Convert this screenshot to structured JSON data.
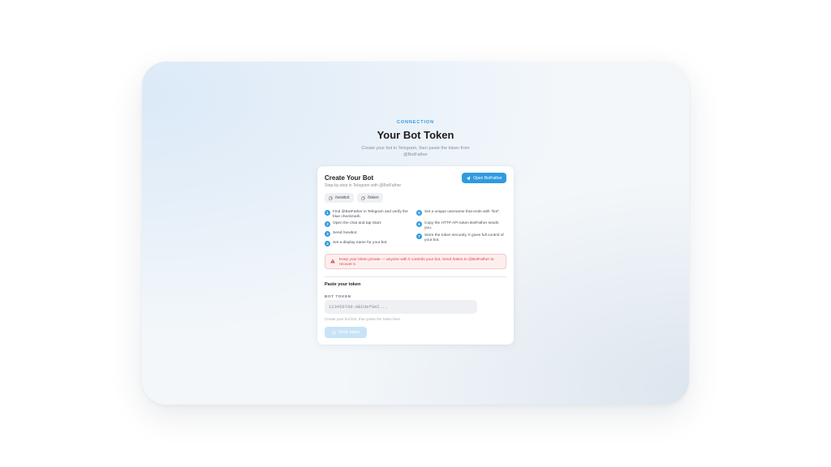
{
  "header": {
    "kicker": "CONNECTION",
    "title": "Your Bot Token",
    "subtitle": "Create your bot in Telegram, then paste the token from @BotFather"
  },
  "card": {
    "title": "Create Your Bot",
    "subtitle": "Step-by-step in Telegram with @BotFather",
    "open_button": "Open BotFather",
    "chips": [
      "/newbot",
      "/token"
    ],
    "steps": [
      {
        "num": "1",
        "text": "Find @BotFather in Telegram and verify the blue checkmark."
      },
      {
        "num": "2",
        "text": "Open the chat and tap Start."
      },
      {
        "num": "3",
        "text": "Send /newbot."
      },
      {
        "num": "4",
        "text": "Set a display name for your bot."
      },
      {
        "num": "5",
        "text": "Set a unique username that ends with \"bot\"."
      },
      {
        "num": "6",
        "text": "Copy the HTTP API token BotFather sends you."
      },
      {
        "num": "7",
        "text": "Store the token securely. It gives full control of your bot."
      }
    ],
    "warning": "Keep your token private — anyone with it controls your bot. Send /token to @BotFather to recover it.",
    "paste_title": "Paste your token",
    "field_label": "BOT TOKEN",
    "token_placeholder": "123456789:ABCdefGHI...",
    "token_value": "",
    "hint": "Create your bot first, then paste the token here.",
    "verify_button": "Verify token"
  },
  "colors": {
    "accent": "#2f9ae0",
    "warning": "#d64545",
    "disabled_button": "#c9e3f6"
  },
  "icons": {
    "open_button": "telegram-send-icon",
    "chip": "copy-icon",
    "warning": "warning-triangle-icon",
    "verify": "check-circle-icon"
  }
}
